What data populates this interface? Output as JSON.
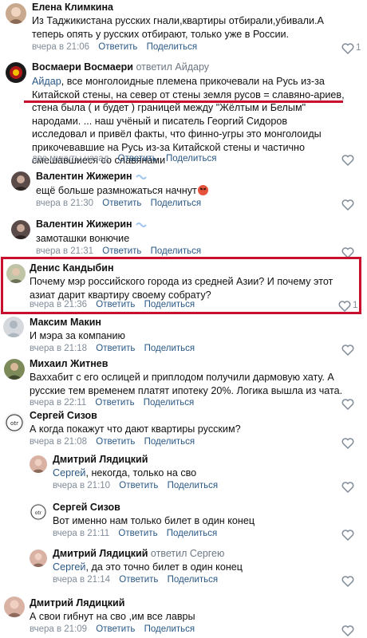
{
  "actions": {
    "reply": "Ответить",
    "share": "Поделиться"
  },
  "colors": {
    "link": "#2a5885",
    "meta": "#818c99",
    "annotation_red": "#c8102e"
  },
  "comments": [
    {
      "author": "Елена Климкина",
      "text": "Из Таджикистана русских гнали,квартиры отбирали,убивали.А теперь опять у русских отбирают, только уже в России.",
      "time": "вчера в 21:06",
      "likes": "1"
    },
    {
      "author": "Восмаери Восмаери",
      "replied": "ответил Айдару",
      "mention": "Айдар",
      "text": ", все монголоидные племена прикочевали на Русь из-за Китайской стены, на север от стены земля русов = славяно-ариев, стена была ( и будет ) границей между \"Жёлтым и Белым\" народами. ... наш учёный и писатель Георгий Сидоров исследовал и привёл факты, что финно-угры это монголоиды прикочевавшие на Русь из-за Китайской стены и частично смешавшиеся со славянами",
      "time": "две минуты назад"
    },
    {
      "author": "Валентин Жижерин",
      "text": "ещё больше размножаться начнут",
      "time": "вчера в 21:30"
    },
    {
      "author": "Валентин Жижерин",
      "text": "замоташки вонючие",
      "time": "вчера в 21:31"
    },
    {
      "author": "Денис Кандыбин",
      "text": "Почему мэр российского города из средней Азии? И почему этот азиат дарит квартиру своему собрату?",
      "time": "вчера в 21:36",
      "likes": "1"
    },
    {
      "author": "Максим Макин",
      "text": "И мэра за компанию",
      "time": "вчера в 21:18"
    },
    {
      "author": "Михаил Житнев",
      "text": "Ваххабит с его ослицей и приплодом получили дармовую хату. А русские тем временем платят ипотеку 20%. Логика вышла из чата.",
      "time": "вчера в 22:11"
    },
    {
      "author": "Сергей Сизов",
      "text": "А когда покажут что дают квартиры русским?",
      "time": "вчера в 21:08"
    },
    {
      "author": "Дмитрий Лядицкий",
      "mention": "Сергей",
      "text": ", некогда, только на сво",
      "time": "вчера в 21:10"
    },
    {
      "author": "Сергей Сизов",
      "text": "Вот именно нам только билет в один конец",
      "time": "вчера в 21:11"
    },
    {
      "author": "Дмитрий Лядицкий",
      "replied": "ответил Сергею",
      "mention": "Сергей",
      "text": ", да это точно билет в один конец",
      "time": "вчера в 21:14"
    },
    {
      "author": "Дмитрий Лядицкий",
      "text": "А свои гибнут на сво ,им все лавры",
      "time": "вчера в 21:09"
    }
  ]
}
